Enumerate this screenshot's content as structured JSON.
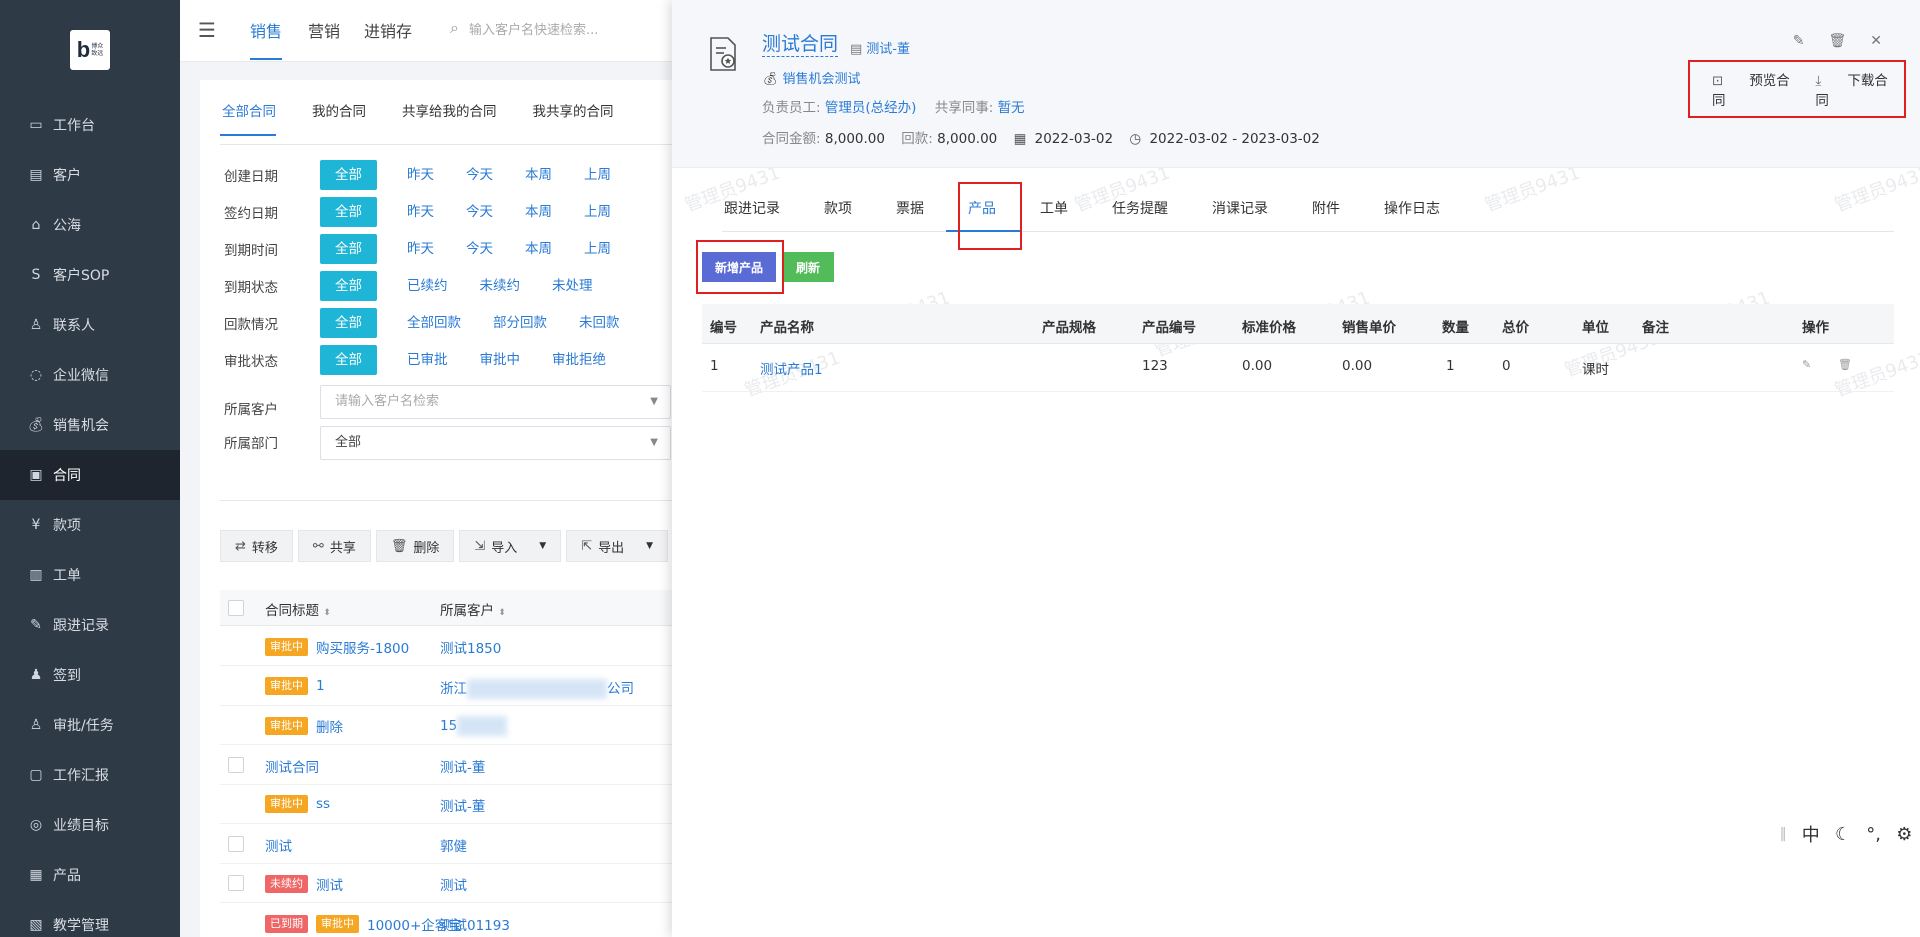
{
  "logo": {
    "lines": "博众\n致远"
  },
  "sidebar": {
    "items": [
      {
        "label": "工作台",
        "icon": "workbench-icon"
      },
      {
        "label": "客户",
        "icon": "customer-icon"
      },
      {
        "label": "公海",
        "icon": "public-pool-icon"
      },
      {
        "label": "客户SOP",
        "icon": "sop-icon"
      },
      {
        "label": "联系人",
        "icon": "contact-icon"
      },
      {
        "label": "企业微信",
        "icon": "wechat-icon"
      },
      {
        "label": "销售机会",
        "icon": "money-bag-icon"
      },
      {
        "label": "合同",
        "icon": "contract-icon"
      },
      {
        "label": "款项",
        "icon": "payment-icon"
      },
      {
        "label": "工单",
        "icon": "work-order-icon"
      },
      {
        "label": "跟进记录",
        "icon": "follow-up-icon"
      },
      {
        "label": "签到",
        "icon": "check-in-icon"
      },
      {
        "label": "审批/任务",
        "icon": "approval-icon"
      },
      {
        "label": "工作汇报",
        "icon": "report-icon"
      },
      {
        "label": "业绩目标",
        "icon": "target-icon"
      },
      {
        "label": "产品",
        "icon": "product-icon"
      },
      {
        "label": "教学管理",
        "icon": "teaching-icon"
      }
    ],
    "active_index": 7
  },
  "topnav": {
    "tabs": [
      "销售",
      "营销",
      "进销存"
    ],
    "search_placeholder": "输入客户名快速检索..."
  },
  "list": {
    "subtabs": [
      "全部合同",
      "我的合同",
      "共享给我的合同",
      "我共享的合同"
    ],
    "filters": [
      {
        "label": "创建日期",
        "options": [
          "全部",
          "昨天",
          "今天",
          "本周",
          "上周"
        ]
      },
      {
        "label": "签约日期",
        "options": [
          "全部",
          "昨天",
          "今天",
          "本周",
          "上周"
        ]
      },
      {
        "label": "到期时间",
        "options": [
          "全部",
          "昨天",
          "今天",
          "本周",
          "上周"
        ]
      },
      {
        "label": "到期状态",
        "options": [
          "全部",
          "已续约",
          "未续约",
          "未处理"
        ]
      },
      {
        "label": "回款情况",
        "options": [
          "全部",
          "全部回款",
          "部分回款",
          "未回款"
        ]
      },
      {
        "label": "审批状态",
        "options": [
          "全部",
          "已审批",
          "审批中",
          "审批拒绝"
        ]
      }
    ],
    "customer_label": "所属客户",
    "customer_placeholder": "请输入客户名检索",
    "dept_label": "所属部门",
    "dept_value": "全部",
    "toolbar": [
      "转移",
      "共享",
      "删除",
      "导入",
      "导出"
    ],
    "columns": [
      "合同标题",
      "所属客户"
    ],
    "rows": [
      {
        "badges": [
          "审批中"
        ],
        "title": "购买服务-1800",
        "customer": "测试1850",
        "checkbox": false
      },
      {
        "badges": [
          "审批中"
        ],
        "title": "1",
        "customer": "浙江",
        "customer_tail": "公司",
        "checkbox": false
      },
      {
        "badges": [
          "审批中"
        ],
        "title": "删除",
        "customer": "15",
        "checkbox": false
      },
      {
        "badges": [],
        "title": "测试合同",
        "customer": "测试-董",
        "checkbox": true
      },
      {
        "badges": [
          "审批中"
        ],
        "title": "ss",
        "customer": "测试-董",
        "checkbox": false
      },
      {
        "badges": [],
        "title": "测试",
        "customer": "郭健",
        "checkbox": true
      },
      {
        "badges": [
          "未续约"
        ],
        "title": "测试",
        "customer": "测试",
        "checkbox": true
      },
      {
        "badges": [
          "已到期",
          "审批中"
        ],
        "title": "10000+企客宝",
        "customer": "测试01193",
        "checkbox": false
      }
    ]
  },
  "drawer": {
    "title": "测试合同",
    "customer_tag": "测试-董",
    "opportunity": "销售机会测试",
    "owner_label": "负责员工:",
    "owner_value": "管理员(总经办)",
    "share_label": "共享同事:",
    "share_value": "暂无",
    "amount_label": "合同金额:",
    "amount_value": "8,000.00",
    "paid_label": "回款:",
    "paid_value": "8,000.00",
    "sign_date": "2022-03-02",
    "period": "2022-03-02 - 2023-03-02",
    "preview_label": "预览合同",
    "download_label": "下载合同",
    "tabs": [
      "跟进记录",
      "款项",
      "票据",
      "产品",
      "工单",
      "任务提醒",
      "消课记录",
      "附件",
      "操作日志"
    ],
    "active_tab_index": 3,
    "add_product_label": "新增产品",
    "refresh_label": "刷新",
    "table": {
      "headers": [
        "编号",
        "产品名称",
        "产品规格",
        "产品编号",
        "标准价格",
        "销售单价",
        "数量",
        "总价",
        "单位",
        "备注",
        "操作"
      ],
      "rows": [
        {
          "no": "1",
          "name": "测试产品1",
          "spec": "",
          "code": "123",
          "std_price": "0.00",
          "sale_price": "0.00",
          "qty": "1",
          "total": "0",
          "unit": "课时",
          "remark": ""
        }
      ]
    }
  },
  "ime": {
    "lang": "中",
    "punct": "°,"
  }
}
